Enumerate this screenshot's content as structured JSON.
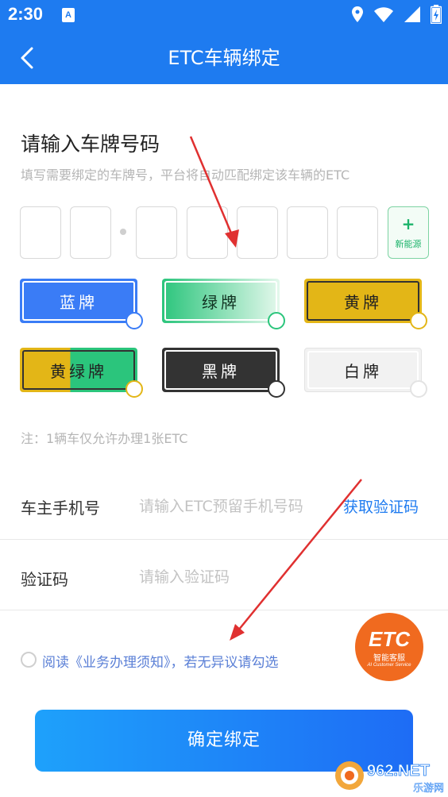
{
  "status_bar": {
    "time": "2:30",
    "notification_badge": "A",
    "icons": [
      "location-icon",
      "wifi-icon",
      "signal-icon",
      "battery-icon"
    ]
  },
  "header": {
    "title": "ETC车辆绑定",
    "back_icon": "back-arrow-icon",
    "background": "#1e7bf0"
  },
  "plate_section": {
    "title": "请输入车牌号码",
    "subtitle": "填写需要绑定的车牌号，平台将自动匹配绑定该车辆的ETC",
    "new_energy_label": "新能源",
    "new_energy_plus": "+"
  },
  "plate_colors": [
    {
      "label": "蓝牌",
      "color": "#3a7cf6",
      "selected": false
    },
    {
      "label": "绿牌",
      "color": "#2fcf85",
      "selected": false
    },
    {
      "label": "黄牌",
      "color": "#e3b617",
      "selected": false
    },
    {
      "label": "黄绿牌",
      "color": "#e3b617",
      "selected": false
    },
    {
      "label": "黑牌",
      "color": "#333333",
      "selected": false
    },
    {
      "label": "白牌",
      "color": "#f2f2f2",
      "selected": false
    }
  ],
  "note": "注：1辆车仅允许办理1张ETC",
  "form": {
    "phone_label": "车主手机号",
    "phone_placeholder": "请输入ETC预留手机号码",
    "get_code": "获取验证码",
    "code_label": "验证码",
    "code_placeholder": "请输入验证码"
  },
  "agreement": {
    "text": "阅读《业务办理须知》，若无异议请勾选"
  },
  "service_badge": {
    "brand": "ETC",
    "subtitle": "智能客服",
    "english": "AI Customer Service"
  },
  "confirm_button": "确定绑定",
  "watermark": {
    "main": "962.NET",
    "sub": "乐游网"
  },
  "colors": {
    "accent": "#1e7bf0",
    "link": "#5a7fd6",
    "arrow": "#e03030",
    "badge": "#f06a1f"
  }
}
